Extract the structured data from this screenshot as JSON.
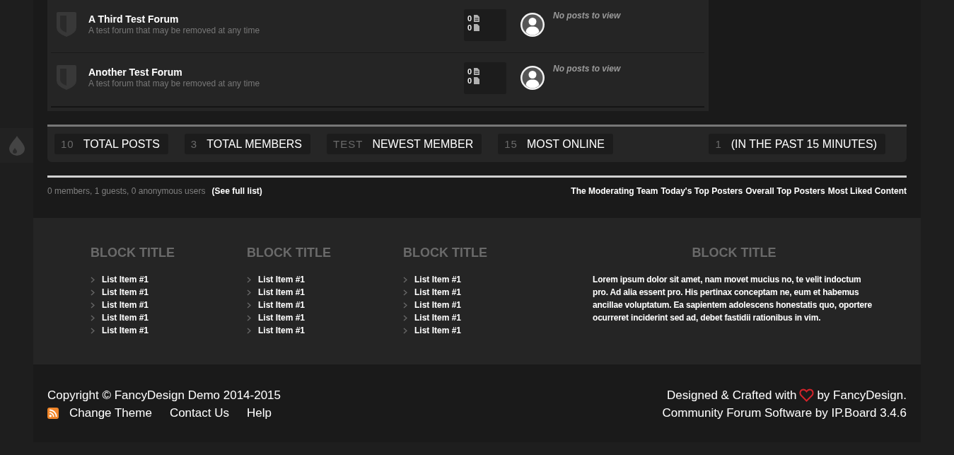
{
  "forums": [
    {
      "title": "A Third Test Forum",
      "description": "A test forum that may be removed at any time",
      "topics": "0",
      "replies": "0",
      "last_post": "No posts to view"
    },
    {
      "title": "Another Test Forum",
      "description": "A test forum that may be removed at any time",
      "topics": "0",
      "replies": "0",
      "last_post": "No posts to view"
    }
  ],
  "stats": [
    {
      "value": "10",
      "label": "TOTAL POSTS"
    },
    {
      "value": "3",
      "label": "TOTAL MEMBERS"
    },
    {
      "value": "TEST",
      "label": "NEWEST MEMBER"
    },
    {
      "value": "15",
      "label": "MOST ONLINE"
    }
  ],
  "recent_online": {
    "value": "1",
    "label": "(IN THE PAST 15 MINUTES)"
  },
  "online_users": {
    "summary": "0 members, 1 guests, 0 anonymous users",
    "link": "(See full list)"
  },
  "quick_links": [
    "The Moderating Team",
    "Today's Top Posters",
    "Overall Top Posters",
    "Most Liked Content"
  ],
  "footer_blocks": [
    {
      "kind": "list",
      "title": "BLOCK TITLE",
      "items": [
        "List Item #1",
        "List Item #1",
        "List Item #1",
        "List Item #1",
        "List Item #1"
      ]
    },
    {
      "kind": "list",
      "title": "BLOCK TITLE",
      "items": [
        "List Item #1",
        "List Item #1",
        "List Item #1",
        "List Item #1",
        "List Item #1"
      ]
    },
    {
      "kind": "list",
      "title": "BLOCK TITLE",
      "items": [
        "List Item #1",
        "List Item #1",
        "List Item #1",
        "List Item #1",
        "List Item #1"
      ]
    },
    {
      "kind": "text",
      "title": "BLOCK TITLE",
      "text": "Lorem ipsum dolor sit amet, nam movet mucius no, te velit indoctum pro. Ad alia essent pro. His pertinax conceptam ne, eum et habemus ancillae voluptatum. Ea sapientem adolescens honestatis quo, oportere ocurreret inciderint sed ad, debet fastidii rationibus in vim."
    }
  ],
  "footer": {
    "copyright": "Copyright © FancyDesign Demo 2014-2015",
    "links": [
      "Change Theme",
      "Contact Us",
      "Help"
    ],
    "credit_before": "Designed & Crafted with",
    "credit_after": "by FancyDesign.",
    "software": "Community Forum Software by IP.Board 3.4.6"
  }
}
